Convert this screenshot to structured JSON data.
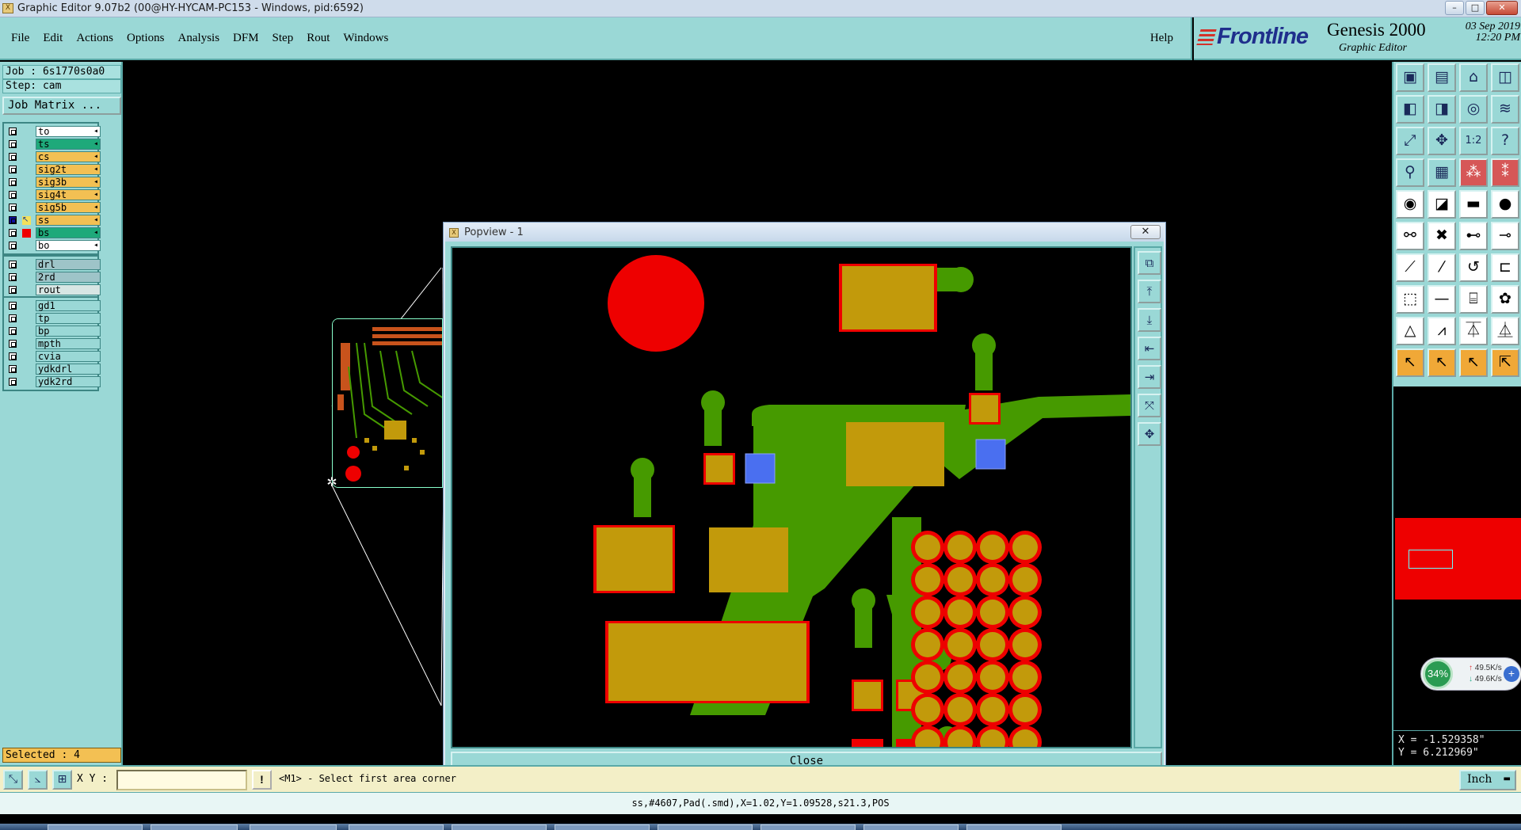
{
  "window": {
    "title": "Graphic Editor 9.07b2 (00@HY-HYCAM-PC153 - Windows, pid:6592)",
    "icon_text": "X",
    "buttons": [
      "–",
      "□",
      "✕"
    ]
  },
  "menu": {
    "items": [
      "File",
      "Edit",
      "Actions",
      "Options",
      "Analysis",
      "DFM",
      "Step",
      "Rout",
      "Windows"
    ],
    "help": "Help"
  },
  "brand": {
    "logo": "Frontline",
    "product": "Genesis 2000",
    "subtitle": "Graphic Editor",
    "date": "03 Sep 2019",
    "time": "12:20 PM"
  },
  "left_panel": {
    "job": "Job : 6s1770s0a0",
    "step": "Step: cam",
    "job_matrix": "Job Matrix ...",
    "layers": [
      {
        "name": "to",
        "color": "#ffffff",
        "checked": false
      },
      {
        "name": "ts",
        "color": "#1ea97a",
        "checked": false
      },
      {
        "name": "cs",
        "color": "#f3c053",
        "checked": false
      },
      {
        "name": "sig2t",
        "color": "#f3c053",
        "checked": false
      },
      {
        "name": "sig3b",
        "color": "#f3c053",
        "checked": false
      },
      {
        "name": "sig4t",
        "color": "#f3c053",
        "checked": false
      },
      {
        "name": "sig5b",
        "color": "#f3c053",
        "checked": false
      },
      {
        "name": "ss",
        "color": "#f3c053",
        "checked": true
      },
      {
        "name": "bs",
        "color": "#1ea97a",
        "checked": false
      },
      {
        "name": "bo",
        "color": "#ffffff",
        "checked": false
      }
    ],
    "drill_layers": [
      {
        "name": "drl",
        "color": "#9ec4c8"
      },
      {
        "name": "2rd",
        "color": "#9ec4c8"
      },
      {
        "name": "rout",
        "color": "#d7e6e4"
      }
    ],
    "doc_layers": [
      {
        "name": "gd1",
        "color": "#9ad8d6"
      },
      {
        "name": "tp",
        "color": "#9ad8d6"
      },
      {
        "name": "bp",
        "color": "#9ad8d6"
      },
      {
        "name": "mpth",
        "color": "#9ad8d6"
      },
      {
        "name": "cvia",
        "color": "#9ad8d6"
      },
      {
        "name": "ydkdrl",
        "color": "#9ad8d6"
      },
      {
        "name": "ydk2rd",
        "color": "#9ad8d6"
      }
    ],
    "selected": "Selected : 4"
  },
  "popview": {
    "title": "Popview - 1",
    "close_x": "✕",
    "close_button": "Close",
    "tools": [
      "⧉",
      "⤒",
      "⤓",
      "⇤",
      "⇥",
      "⤧",
      "✥"
    ]
  },
  "right_tools": {
    "rows": [
      [
        {
          "icon": "▣",
          "style": "norm",
          "name": "open-icon"
        },
        {
          "icon": "▤",
          "style": "norm",
          "name": "save-icon"
        },
        {
          "icon": "⌂",
          "style": "norm",
          "name": "home-icon"
        },
        {
          "icon": "◫",
          "style": "norm",
          "name": "window-icon"
        }
      ],
      [
        {
          "icon": "◧",
          "style": "norm",
          "name": "layer-left-icon"
        },
        {
          "icon": "◨",
          "style": "norm",
          "name": "layer-right-icon"
        },
        {
          "icon": "◎",
          "style": "norm",
          "name": "snap-icon"
        },
        {
          "icon": "≋",
          "style": "norm",
          "name": "pattern-icon"
        }
      ],
      [
        {
          "icon": "⤢",
          "style": "norm",
          "name": "zoom-fit-icon"
        },
        {
          "icon": "✥",
          "style": "norm",
          "name": "pan-icon"
        },
        {
          "icon": "1:2",
          "style": "norm",
          "name": "scale-icon"
        },
        {
          "icon": "?",
          "style": "norm",
          "name": "help-icon"
        }
      ],
      [
        {
          "icon": "⚲",
          "style": "norm",
          "name": "measure-icon"
        },
        {
          "icon": "▦",
          "style": "norm",
          "name": "grid-icon"
        },
        {
          "icon": "⁂",
          "style": "red",
          "name": "net-icon"
        },
        {
          "icon": "⁑",
          "style": "red",
          "name": "net2-icon"
        }
      ],
      [
        {
          "icon": "◉",
          "style": "white",
          "name": "pad-icon"
        },
        {
          "icon": "◪",
          "style": "white",
          "name": "line-mode-icon"
        },
        {
          "icon": "▬",
          "style": "white",
          "name": "ruler-icon"
        },
        {
          "icon": "●",
          "style": "white",
          "name": "circle-icon"
        }
      ],
      [
        {
          "icon": "⚯",
          "style": "white",
          "name": "connect-icon"
        },
        {
          "icon": "✖",
          "style": "white",
          "name": "cross-icon"
        },
        {
          "icon": "⊷",
          "style": "white",
          "name": "link-icon"
        },
        {
          "icon": "⊸",
          "style": "white",
          "name": "link2-icon"
        }
      ],
      [
        {
          "icon": "⟋",
          "style": "white",
          "name": "line-icon"
        },
        {
          "icon": "⁄",
          "style": "white",
          "name": "slash-icon"
        },
        {
          "icon": "↺",
          "style": "white",
          "name": "arc-icon"
        },
        {
          "icon": "⊏",
          "style": "white",
          "name": "bracket-icon"
        }
      ],
      [
        {
          "icon": "⬚",
          "style": "white",
          "name": "rect-select-icon"
        },
        {
          "icon": "—",
          "style": "white",
          "name": "hline-icon"
        },
        {
          "icon": "⌸",
          "style": "white",
          "name": "box-icon"
        },
        {
          "icon": "✿",
          "style": "white",
          "name": "flower-icon"
        }
      ],
      [
        {
          "icon": "△",
          "style": "white",
          "name": "triangle-icon"
        },
        {
          "icon": "⩘",
          "style": "white",
          "name": "triangle2-icon"
        },
        {
          "icon": "⏄",
          "style": "white",
          "name": "triangle3-icon"
        },
        {
          "icon": "⏅",
          "style": "white",
          "name": "triangle4-icon"
        }
      ],
      [
        {
          "icon": "↖",
          "style": "orange",
          "name": "pointer-icon"
        },
        {
          "icon": "↖",
          "style": "orange",
          "name": "pointer2-icon"
        },
        {
          "icon": "↖",
          "style": "orange",
          "name": "pointer3-icon"
        },
        {
          "icon": "⇱",
          "style": "orange",
          "name": "pointer4-icon"
        }
      ]
    ]
  },
  "network": {
    "percent": "34%",
    "up": "49.5K/s",
    "down": "49.6K/s"
  },
  "coords": {
    "x": "X = -1.529358\"",
    "y": "Y = 6.212969\""
  },
  "bottom": {
    "xy_label": "X Y :",
    "xy_value": "",
    "excl": "!",
    "message": "<M1> - Select first area corner",
    "unit": "Inch"
  },
  "status": "ss,#4607,Pad(.smd),X=1.02,Y=1.09528,s21.3,POS",
  "colors": {
    "copper": "#c29a0b",
    "trace": "#469a00",
    "pad_red": "#ee0000",
    "via_blue": "#4a6ff0"
  }
}
